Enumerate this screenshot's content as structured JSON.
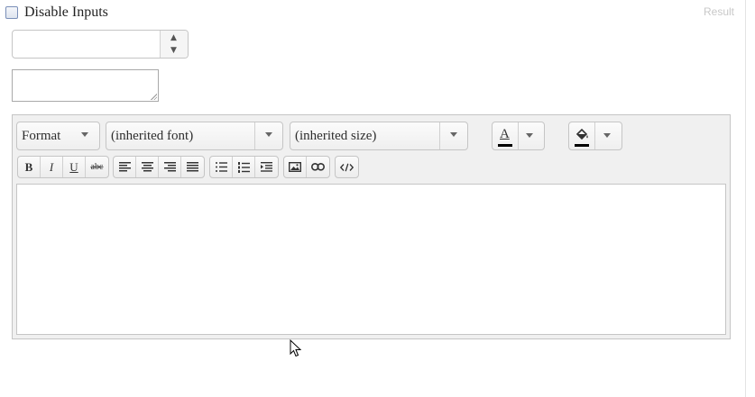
{
  "header": {
    "disable_label": "Disable Inputs",
    "result_label": "Result"
  },
  "numeric": {
    "value": "",
    "up_glyph": "▲",
    "down_glyph": "▼"
  },
  "textarea": {
    "value": ""
  },
  "toolbar": {
    "format_value": "Format",
    "font_value": "(inherited font)",
    "size_value": "(inherited size)",
    "bold_label": "B",
    "italic_label": "I",
    "underline_label": "U",
    "strike_label": "abc",
    "text_color_letter": "A",
    "text_color": "#000000",
    "back_color": "#000000"
  },
  "icons": {
    "font_color": "font-color-icon",
    "back_color": "back-color-icon",
    "justify_left": "justify-left-icon",
    "justify_center": "justify-center-icon",
    "justify_right": "justify-right-icon",
    "justify_full": "justify-full-icon",
    "unordered_list": "unordered-list-icon",
    "ordered_list": "ordered-list-icon",
    "indent": "indent-icon",
    "insert_image": "insert-image-icon",
    "create_link": "create-link-icon",
    "view_html": "view-html-icon"
  }
}
